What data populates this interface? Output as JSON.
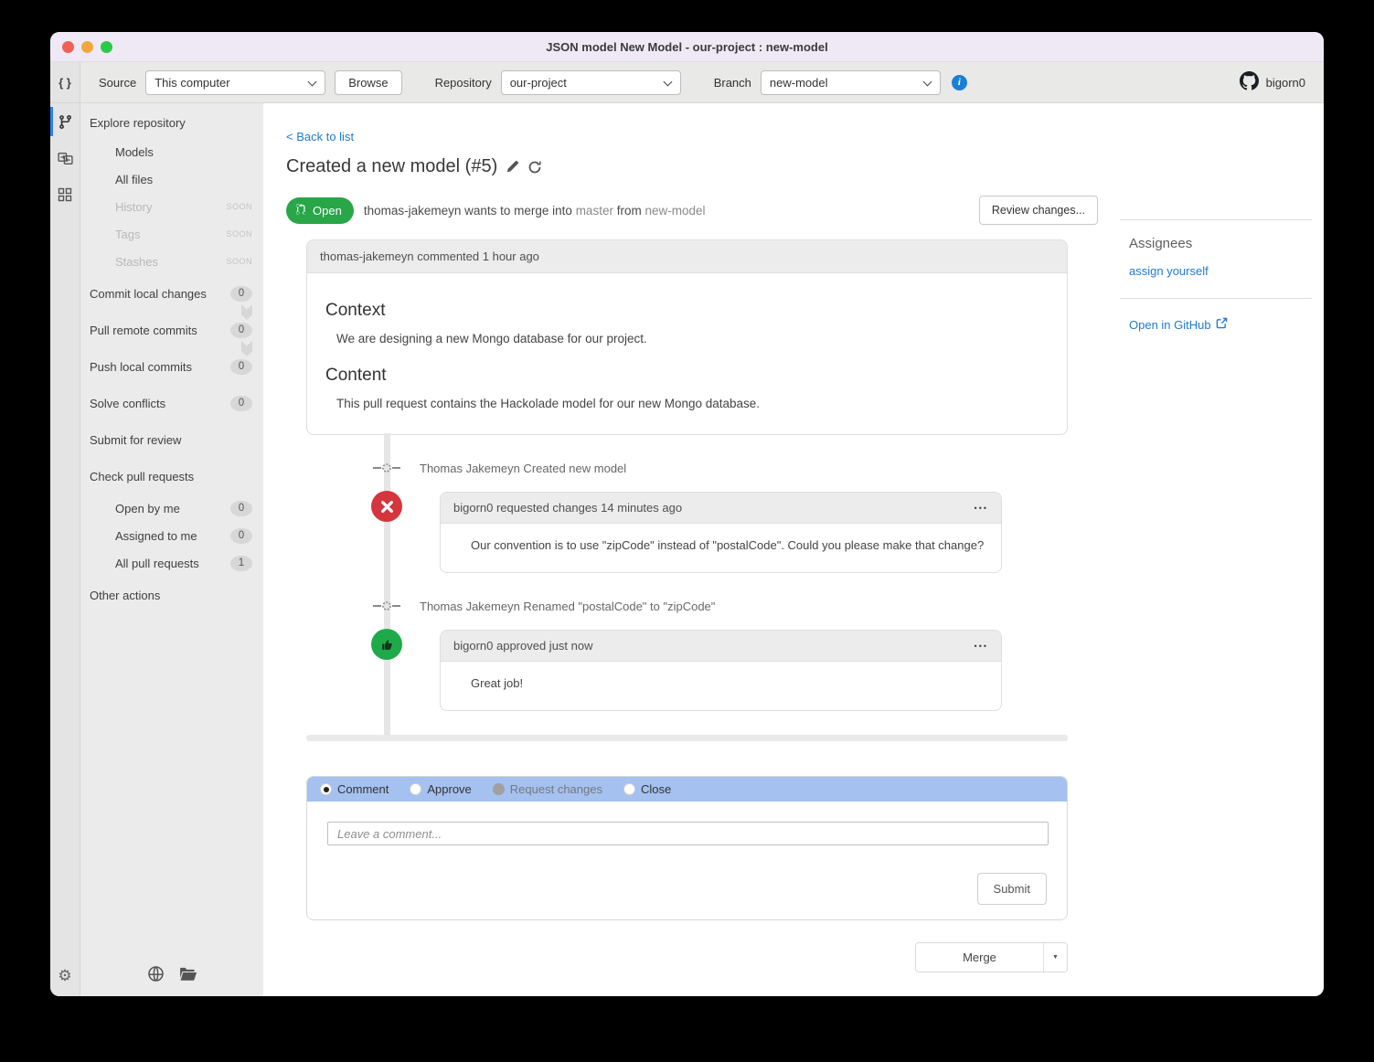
{
  "window": {
    "title": "JSON model New Model - our-project : new-model"
  },
  "toolbar": {
    "source_label": "Source",
    "source_value": "This computer",
    "browse_label": "Browse",
    "repository_label": "Repository",
    "repository_value": "our-project",
    "branch_label": "Branch",
    "branch_value": "new-model",
    "user": "bigorn0"
  },
  "sidebar": {
    "soon_label": "SOON",
    "items": [
      {
        "label": "Explore repository"
      },
      {
        "label": "Models"
      },
      {
        "label": "All files"
      },
      {
        "label": "History"
      },
      {
        "label": "Tags"
      },
      {
        "label": "Stashes"
      },
      {
        "label": "Commit local changes",
        "badge": "0"
      },
      {
        "label": "Pull remote commits",
        "badge": "0"
      },
      {
        "label": "Push local commits",
        "badge": "0"
      },
      {
        "label": "Solve conflicts",
        "badge": "0"
      },
      {
        "label": "Submit for review"
      },
      {
        "label": "Check pull requests"
      },
      {
        "label": "Open by me",
        "badge": "0"
      },
      {
        "label": "Assigned to me",
        "badge": "0"
      },
      {
        "label": "All pull requests",
        "badge": "1"
      },
      {
        "label": "Other actions"
      }
    ]
  },
  "main": {
    "back_link": "< Back to list",
    "title": "Created a new model (#5)",
    "status": {
      "badge": "Open",
      "text_pre": "thomas-jakemeyn wants to merge into",
      "branch_target": "master",
      "text_mid": "from",
      "branch_source": "new-model"
    },
    "review_button": "Review changes...",
    "description_card": {
      "header": "thomas-jakemeyn commented 1 hour ago",
      "sections": [
        {
          "heading": "Context",
          "text": "We are designing a new Mongo database for our project."
        },
        {
          "heading": "Content",
          "text": "This pull request contains the Hackolade model for our new Mongo database."
        }
      ]
    },
    "timeline": [
      {
        "type": "event",
        "text": "Thomas Jakemeyn Created new model"
      },
      {
        "type": "comment",
        "header": "bigorn0  requested changes 14 minutes ago",
        "body": "Our convention is to use \"zipCode\" instead of \"postalCode\". Could you please make that change?"
      },
      {
        "type": "event",
        "text": "Thomas Jakemeyn Renamed \"postalCode\" to \"zipCode\""
      },
      {
        "type": "comment",
        "header": "bigorn0  approved just now",
        "body": "Great job!"
      }
    ],
    "comment_form": {
      "options": [
        {
          "label": "Comment"
        },
        {
          "label": "Approve"
        },
        {
          "label": "Request changes"
        },
        {
          "label": "Close"
        }
      ],
      "placeholder": "Leave a comment...",
      "submit_label": "Submit"
    },
    "merge_button": "Merge"
  },
  "right_panel": {
    "assignees_title": "Assignees",
    "assign_link": "assign yourself",
    "github_link": "Open in GitHub"
  },
  "icons": {
    "braces": "{ }",
    "gear": "⚙",
    "ellipsis": "•••",
    "dropdown_arrow": "▼",
    "info": "i"
  },
  "colors": {
    "titlebar": "#efe9f6",
    "open_badge": "#28a648",
    "request_changes": "#d5353d",
    "approved": "#1faa4a",
    "form_header": "#a4c1f0",
    "link": "#1f7ad0",
    "accent_rail": "#2e7ef0"
  }
}
